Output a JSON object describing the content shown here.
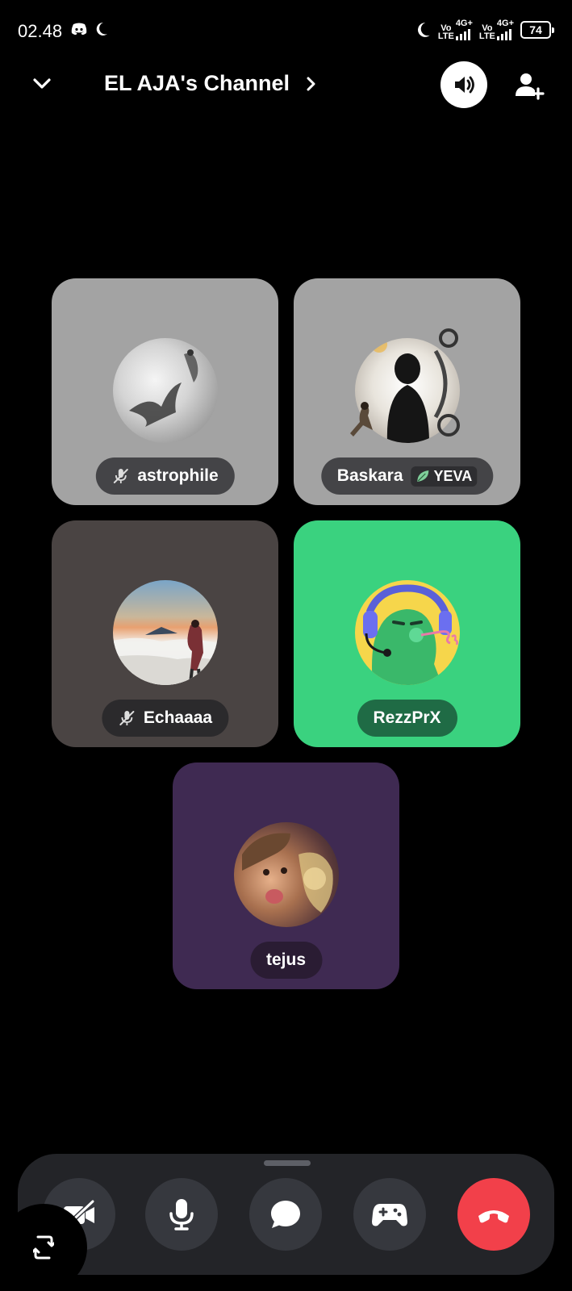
{
  "status_bar": {
    "time": "02.48",
    "icons": [
      "discord-icon",
      "moon-icon"
    ],
    "right_icons": [
      "moon-icon"
    ],
    "sim1_label_top": "Vo",
    "sim1_label_bottom": "LTE",
    "sim1_net": "4G+",
    "sim2_label_top": "Vo",
    "sim2_label_bottom": "LTE",
    "sim2_net": "4G+",
    "battery": "74"
  },
  "header": {
    "channel_name": "EL AJA's Channel",
    "icons": [
      "chevron-down-icon",
      "chevron-right-icon",
      "speaker-icon",
      "add-user-icon"
    ]
  },
  "participants": [
    {
      "name": "astrophile",
      "muted": true,
      "tile_color": "#a3a3a3",
      "avatar_style": "birds-grayscale"
    },
    {
      "name": "Baskara",
      "muted": false,
      "tile_color": "#a3a3a3",
      "badge": "YEVA",
      "badge_icon": "leaf-icon",
      "avatar_style": "silhouette-decorated"
    },
    {
      "name": "Echaaaa",
      "muted": true,
      "tile_color": "#4a4443",
      "avatar_style": "mountain-clouds"
    },
    {
      "name": "RezzPrX",
      "muted": false,
      "tile_color": "#3ad27f",
      "nametag_color": "#1f6b45",
      "avatar_style": "discord-default-green"
    },
    {
      "name": "tejus",
      "muted": false,
      "tile_color": "#3f2a52",
      "avatar_style": "child-photo"
    }
  ],
  "controls": {
    "buttons": [
      "camera-off-icon",
      "microphone-icon",
      "chat-icon",
      "game-controller-icon",
      "hang-up-icon"
    ],
    "hangup_color": "#f2404a",
    "switch_camera": "switch-camera-icon"
  }
}
